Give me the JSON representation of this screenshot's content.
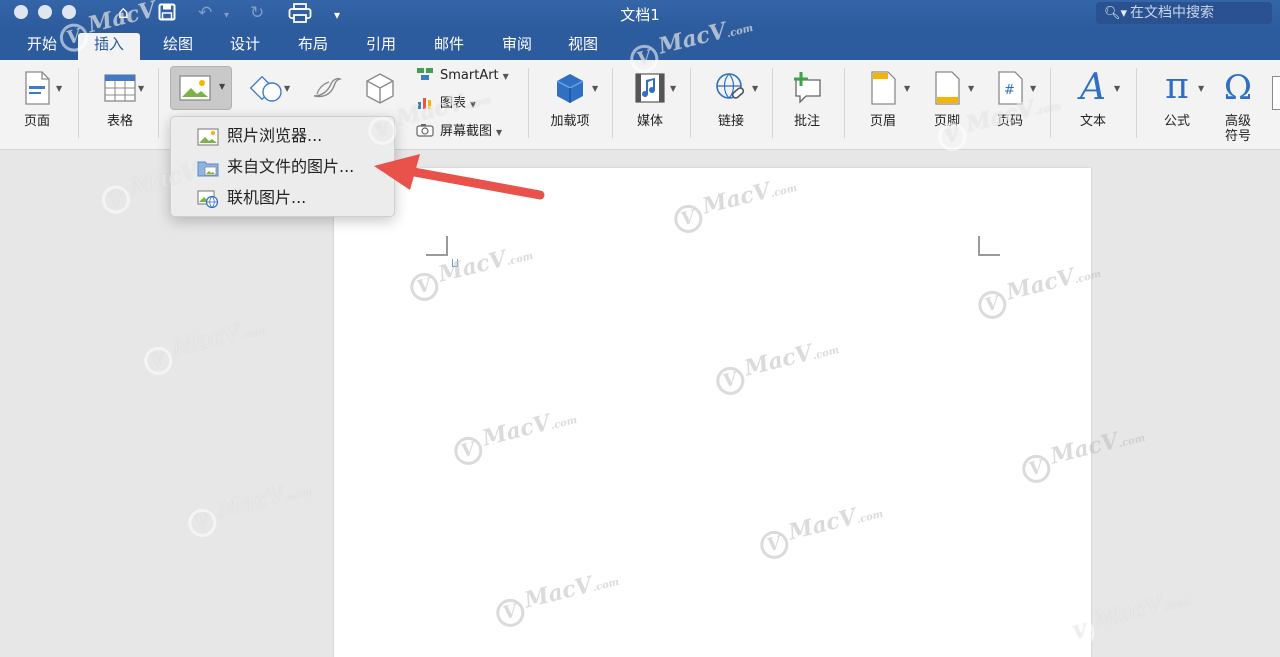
{
  "window": {
    "title": "文档1"
  },
  "search": {
    "placeholder": "在文档中搜索"
  },
  "tabs": [
    "开始",
    "插入",
    "绘图",
    "设计",
    "布局",
    "引用",
    "邮件",
    "审阅",
    "视图"
  ],
  "active_tab": "插入",
  "ribbon": {
    "page": "页面",
    "table": "表格",
    "smartart": "SmartArt",
    "chart": "图表",
    "screenshot": "屏幕截图",
    "addins": "加载项",
    "media": "媒体",
    "link": "链接",
    "comment": "批注",
    "header": "页眉",
    "footer": "页脚",
    "page_number": "页码",
    "text": "文本",
    "equation": "公式",
    "symbol_line1": "高级",
    "symbol_line2": "符号"
  },
  "picture_menu": {
    "items": [
      "照片浏览器...",
      "来自文件的图片...",
      "联机图片..."
    ]
  },
  "watermark": {
    "text": "MacV",
    "suffix": ".com"
  },
  "colors": {
    "titlebar": "#2d5c9e",
    "ribbon_bg": "#f3f3f3",
    "canvas_bg": "#e7e7e7",
    "arrow": "#e8524a",
    "accent_blue": "#2f6fc4"
  }
}
